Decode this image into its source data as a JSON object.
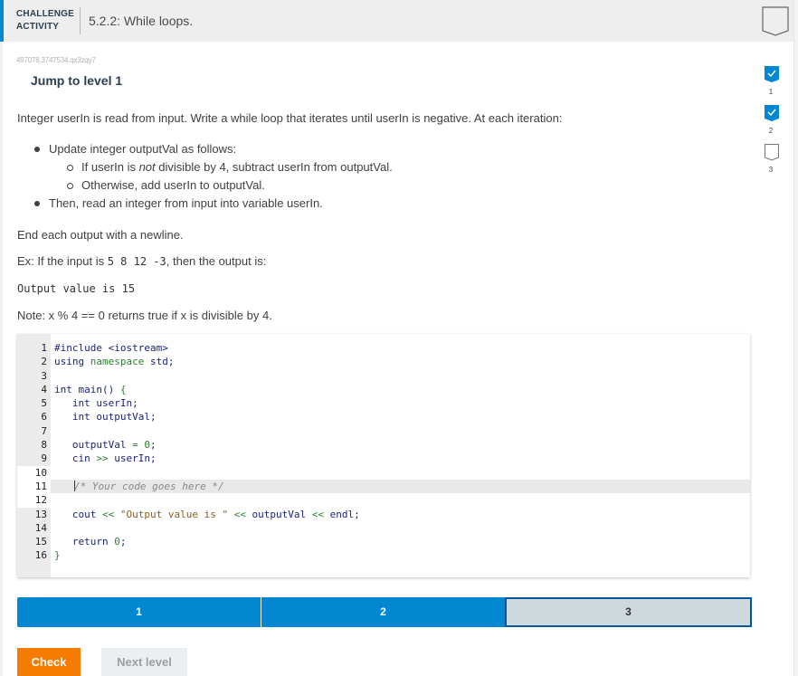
{
  "header": {
    "label_line1": "CHALLENGE",
    "label_line2": "ACTIVITY",
    "title": "5.2.2: While loops.",
    "accent_color": "#0288d1",
    "bookmark_icon": "bookmark-icon"
  },
  "activity_id": "497078.3747534.qx3zqy7",
  "jump_label": "Jump to level 1",
  "side_progress": [
    {
      "label": "1",
      "status": "completed",
      "icon": "check-icon"
    },
    {
      "label": "2",
      "status": "completed",
      "icon": "check-icon"
    },
    {
      "label": "3",
      "status": "incomplete",
      "icon": "empty-badge-icon"
    }
  ],
  "instructions": {
    "intro": "Integer userIn is read from input. Write a while loop that iterates until userIn is negative. At each iteration:",
    "bullet1": "Update integer outputVal as follows:",
    "sub1_pre": "If userIn is ",
    "sub1_em": "not",
    "sub1_post": " divisible by 4, subtract userIn from outputVal.",
    "sub2": "Otherwise, add userIn to outputVal.",
    "bullet2": "Then, read an integer from input into variable userIn.",
    "end_note": "End each output with a newline.",
    "example_pre": "Ex: If the input is ",
    "example_input": "5 8 12 -3",
    "example_post": ", then the output is:",
    "example_output": "Output value is 15",
    "note": "Note: x % 4 == 0 returns true if x is divisible by 4."
  },
  "code": {
    "line_numbers": [
      "1",
      "2",
      "3",
      "4",
      "5",
      "6",
      "7",
      "8",
      "9",
      "10",
      "11",
      "12",
      "13",
      "14",
      "15",
      "16"
    ],
    "l1_a": "#include ",
    "l1_b": "<iostream>",
    "l2_a": "using",
    "l2_b": " namespace ",
    "l2_c": "std;",
    "l4_a": "int",
    "l4_b": " main() ",
    "l4_c": "{",
    "l5_a": "   int",
    "l5_b": " userIn;",
    "l6_a": "   int",
    "l6_b": " outputVal;",
    "l8_a": "   outputVal ",
    "l8_b": "= ",
    "l8_c": "0",
    "l8_d": ";",
    "l9_a": "   cin ",
    "l9_b": ">>",
    "l9_c": " userIn;",
    "l11": "/* Your code goes here */",
    "l13_a": "   cout ",
    "l13_b": "<<",
    "l13_c": " \"Output value is \" ",
    "l13_d": "<<",
    "l13_e": " outputVal ",
    "l13_f": "<<",
    "l13_g": " endl;",
    "l15_a": "   return ",
    "l15_b": "0",
    "l15_c": ";",
    "l16": "}"
  },
  "levels": [
    {
      "label": "1",
      "status": "completed"
    },
    {
      "label": "2",
      "status": "completed"
    },
    {
      "label": "3",
      "status": "current"
    }
  ],
  "buttons": {
    "check": "Check",
    "next_level": "Next level"
  }
}
